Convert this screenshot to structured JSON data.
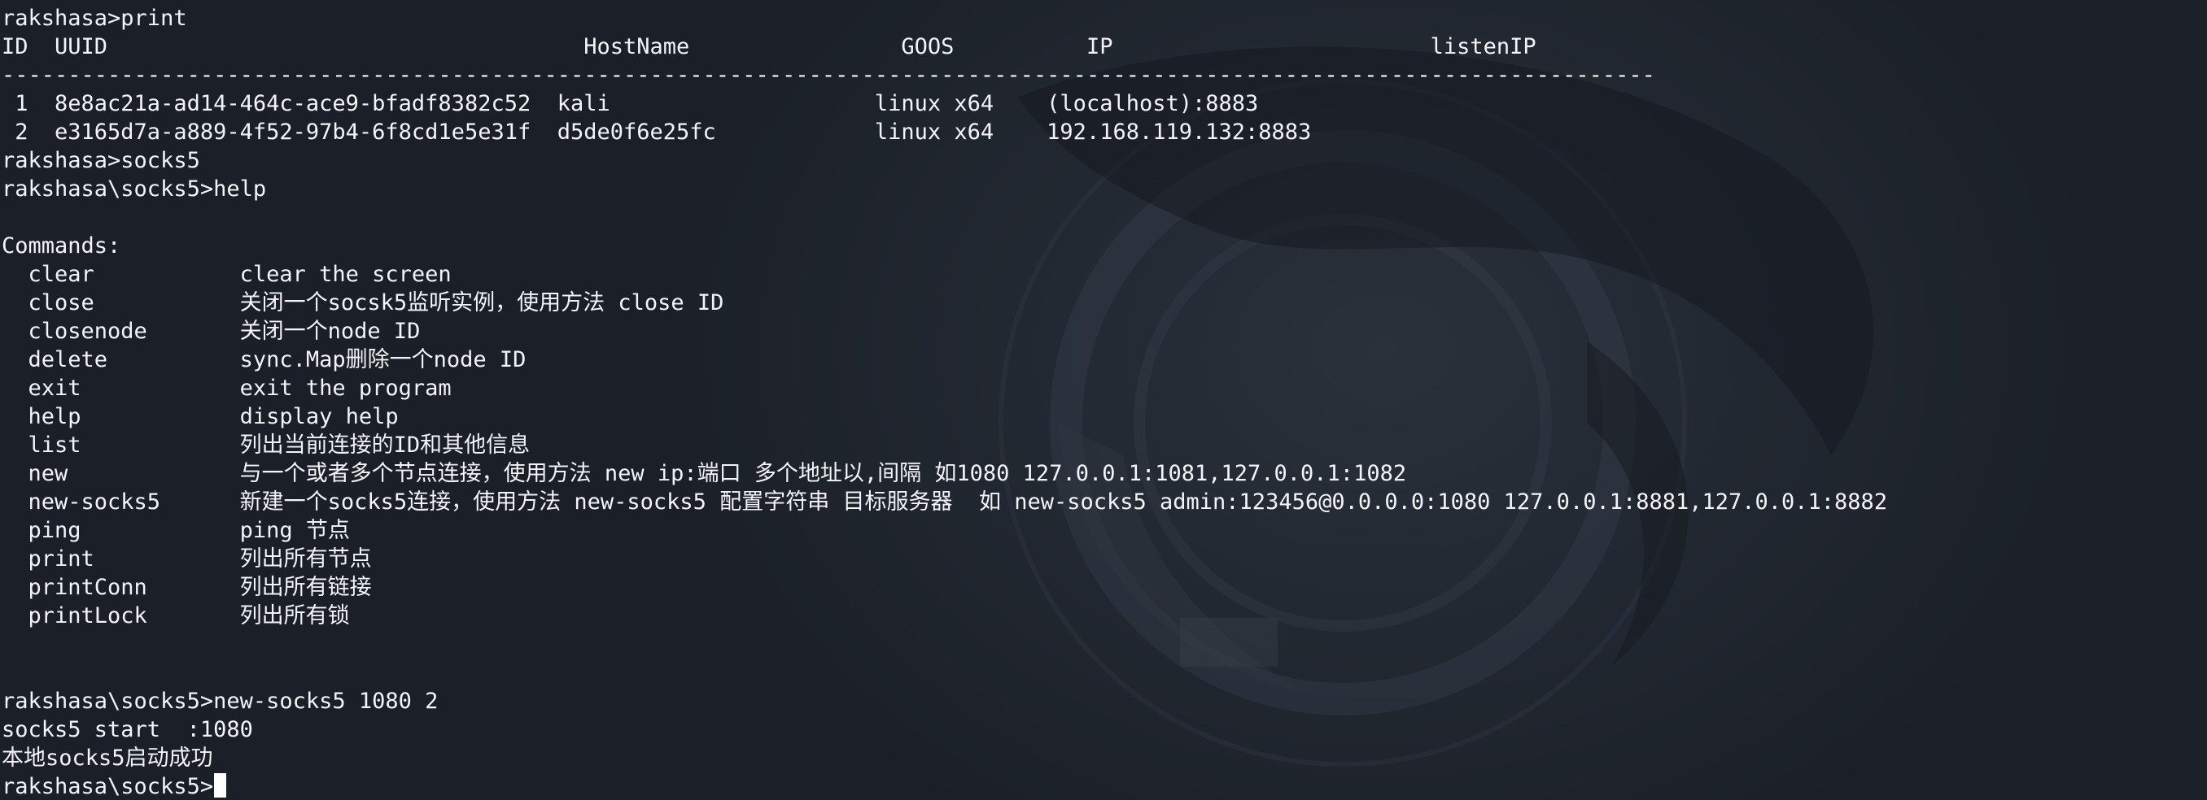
{
  "terminal": {
    "lines": [
      "rakshasa>print",
      "ID  UUID                                    HostName                GOOS          IP                        listenIP",
      "-----------------------------------------------------------------------------------------------------------------------------",
      " 1  8e8ac21a-ad14-464c-ace9-bfadf8382c52  kali                    linux x64    (localhost):8883",
      " 2  e3165d7a-a889-4f52-97b4-6f8cd1e5e31f  d5de0f6e25fc            linux x64    192.168.119.132:8883",
      "rakshasa>socks5",
      "rakshasa\\socks5>help",
      "",
      "Commands:",
      "  clear           clear the screen",
      "  close           关闭一个socsk5监听实例，使用方法 close ID",
      "  closenode       关闭一个node ID",
      "  delete          sync.Map删除一个node ID",
      "  exit            exit the program",
      "  help            display help",
      "  list            列出当前连接的ID和其他信息",
      "  new             与一个或者多个节点连接，使用方法 new ip:端口 多个地址以,间隔 如1080 127.0.0.1:1081,127.0.0.1:1082",
      "  new-socks5      新建一个socks5连接，使用方法 new-socks5 配置字符串 目标服务器  如 new-socks5 admin:123456@0.0.0.0:1080 127.0.0.1:8881,127.0.0.1:8882",
      "  ping            ping 节点",
      "  print           列出所有节点",
      "  printConn       列出所有链接",
      "  printLock       列出所有锁",
      "",
      "",
      "rakshasa\\socks5>new-socks5 1080 2",
      "socks5 start  :1080",
      "本地socks5启动成功"
    ],
    "prompt": "rakshasa\\socks5>"
  }
}
